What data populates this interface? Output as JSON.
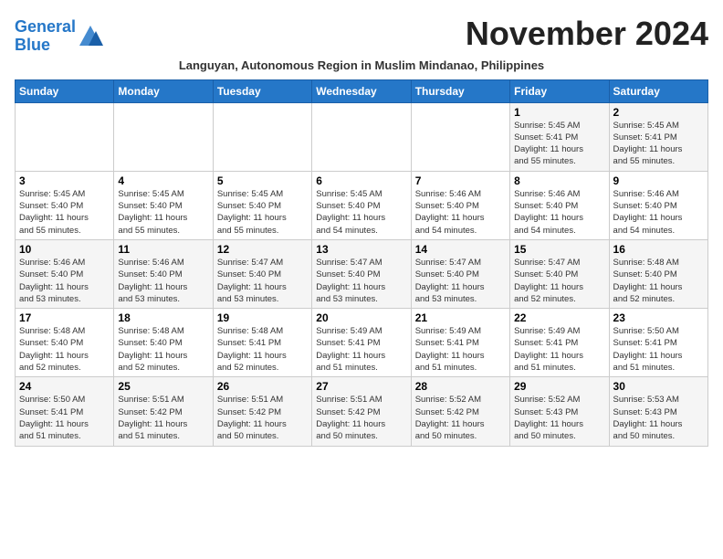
{
  "logo": {
    "line1": "General",
    "line2": "Blue"
  },
  "title": "November 2024",
  "subtitle": "Languyan, Autonomous Region in Muslim Mindanao, Philippines",
  "weekdays": [
    "Sunday",
    "Monday",
    "Tuesday",
    "Wednesday",
    "Thursday",
    "Friday",
    "Saturday"
  ],
  "weeks": [
    [
      {
        "day": "",
        "info": ""
      },
      {
        "day": "",
        "info": ""
      },
      {
        "day": "",
        "info": ""
      },
      {
        "day": "",
        "info": ""
      },
      {
        "day": "",
        "info": ""
      },
      {
        "day": "1",
        "info": "Sunrise: 5:45 AM\nSunset: 5:41 PM\nDaylight: 11 hours\nand 55 minutes."
      },
      {
        "day": "2",
        "info": "Sunrise: 5:45 AM\nSunset: 5:41 PM\nDaylight: 11 hours\nand 55 minutes."
      }
    ],
    [
      {
        "day": "3",
        "info": "Sunrise: 5:45 AM\nSunset: 5:40 PM\nDaylight: 11 hours\nand 55 minutes."
      },
      {
        "day": "4",
        "info": "Sunrise: 5:45 AM\nSunset: 5:40 PM\nDaylight: 11 hours\nand 55 minutes."
      },
      {
        "day": "5",
        "info": "Sunrise: 5:45 AM\nSunset: 5:40 PM\nDaylight: 11 hours\nand 55 minutes."
      },
      {
        "day": "6",
        "info": "Sunrise: 5:45 AM\nSunset: 5:40 PM\nDaylight: 11 hours\nand 54 minutes."
      },
      {
        "day": "7",
        "info": "Sunrise: 5:46 AM\nSunset: 5:40 PM\nDaylight: 11 hours\nand 54 minutes."
      },
      {
        "day": "8",
        "info": "Sunrise: 5:46 AM\nSunset: 5:40 PM\nDaylight: 11 hours\nand 54 minutes."
      },
      {
        "day": "9",
        "info": "Sunrise: 5:46 AM\nSunset: 5:40 PM\nDaylight: 11 hours\nand 54 minutes."
      }
    ],
    [
      {
        "day": "10",
        "info": "Sunrise: 5:46 AM\nSunset: 5:40 PM\nDaylight: 11 hours\nand 53 minutes."
      },
      {
        "day": "11",
        "info": "Sunrise: 5:46 AM\nSunset: 5:40 PM\nDaylight: 11 hours\nand 53 minutes."
      },
      {
        "day": "12",
        "info": "Sunrise: 5:47 AM\nSunset: 5:40 PM\nDaylight: 11 hours\nand 53 minutes."
      },
      {
        "day": "13",
        "info": "Sunrise: 5:47 AM\nSunset: 5:40 PM\nDaylight: 11 hours\nand 53 minutes."
      },
      {
        "day": "14",
        "info": "Sunrise: 5:47 AM\nSunset: 5:40 PM\nDaylight: 11 hours\nand 53 minutes."
      },
      {
        "day": "15",
        "info": "Sunrise: 5:47 AM\nSunset: 5:40 PM\nDaylight: 11 hours\nand 52 minutes."
      },
      {
        "day": "16",
        "info": "Sunrise: 5:48 AM\nSunset: 5:40 PM\nDaylight: 11 hours\nand 52 minutes."
      }
    ],
    [
      {
        "day": "17",
        "info": "Sunrise: 5:48 AM\nSunset: 5:40 PM\nDaylight: 11 hours\nand 52 minutes."
      },
      {
        "day": "18",
        "info": "Sunrise: 5:48 AM\nSunset: 5:40 PM\nDaylight: 11 hours\nand 52 minutes."
      },
      {
        "day": "19",
        "info": "Sunrise: 5:48 AM\nSunset: 5:41 PM\nDaylight: 11 hours\nand 52 minutes."
      },
      {
        "day": "20",
        "info": "Sunrise: 5:49 AM\nSunset: 5:41 PM\nDaylight: 11 hours\nand 51 minutes."
      },
      {
        "day": "21",
        "info": "Sunrise: 5:49 AM\nSunset: 5:41 PM\nDaylight: 11 hours\nand 51 minutes."
      },
      {
        "day": "22",
        "info": "Sunrise: 5:49 AM\nSunset: 5:41 PM\nDaylight: 11 hours\nand 51 minutes."
      },
      {
        "day": "23",
        "info": "Sunrise: 5:50 AM\nSunset: 5:41 PM\nDaylight: 11 hours\nand 51 minutes."
      }
    ],
    [
      {
        "day": "24",
        "info": "Sunrise: 5:50 AM\nSunset: 5:41 PM\nDaylight: 11 hours\nand 51 minutes."
      },
      {
        "day": "25",
        "info": "Sunrise: 5:51 AM\nSunset: 5:42 PM\nDaylight: 11 hours\nand 51 minutes."
      },
      {
        "day": "26",
        "info": "Sunrise: 5:51 AM\nSunset: 5:42 PM\nDaylight: 11 hours\nand 50 minutes."
      },
      {
        "day": "27",
        "info": "Sunrise: 5:51 AM\nSunset: 5:42 PM\nDaylight: 11 hours\nand 50 minutes."
      },
      {
        "day": "28",
        "info": "Sunrise: 5:52 AM\nSunset: 5:42 PM\nDaylight: 11 hours\nand 50 minutes."
      },
      {
        "day": "29",
        "info": "Sunrise: 5:52 AM\nSunset: 5:43 PM\nDaylight: 11 hours\nand 50 minutes."
      },
      {
        "day": "30",
        "info": "Sunrise: 5:53 AM\nSunset: 5:43 PM\nDaylight: 11 hours\nand 50 minutes."
      }
    ]
  ]
}
